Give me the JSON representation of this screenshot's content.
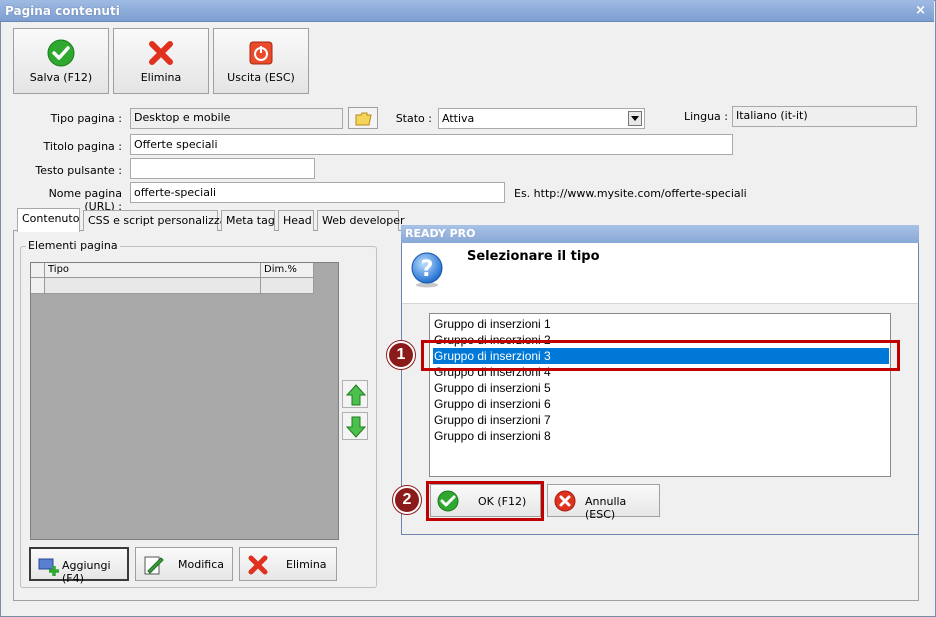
{
  "window": {
    "title": "Pagina contenuti",
    "close_glyph": "×"
  },
  "toolbar": [
    {
      "label": "Salva (F12)",
      "icon": "checkmark-icon"
    },
    {
      "label": "Elimina",
      "icon": "red-x-icon"
    },
    {
      "label": "Uscita (ESC)",
      "icon": "exit-icon"
    }
  ],
  "form": {
    "tipo_pagina_label": "Tipo pagina :",
    "tipo_pagina_value": "Desktop e mobile",
    "stato_label": "Stato :",
    "stato_value": "Attiva",
    "lingua_label": "Lingua :",
    "lingua_value": "Italiano (it-it)",
    "titolo_label": "Titolo pagina :",
    "titolo_value": "Offerte speciali",
    "testo_label": "Testo pulsante :",
    "testo_value": "",
    "nome_label": "Nome pagina (URL) :",
    "nome_value": "offerte-speciali",
    "url_example": "Es. http://www.mysite.com/offerte-speciali"
  },
  "tabs": [
    "Contenuto",
    "CSS e script personalizzati",
    "Meta tag",
    "Head",
    "Web developer"
  ],
  "elements": {
    "group_title": "Elementi pagina",
    "columns": [
      "Tipo",
      "Dim.%"
    ],
    "buttons": [
      "Aggiungi (F4)",
      "Modifica",
      "Elimina"
    ]
  },
  "dialog": {
    "title": "READY PRO",
    "heading": "Selezionare il tipo",
    "items": [
      "Gruppo di inserzioni 1",
      "Gruppo di inserzioni 2",
      "Gruppo di inserzioni 3",
      "Gruppo di inserzioni 4",
      "Gruppo di inserzioni 5",
      "Gruppo di inserzioni 6",
      "Gruppo di inserzioni 7",
      "Gruppo di inserzioni 8"
    ],
    "selected_index": 2,
    "ok_label": "OK (F12)",
    "cancel_label": "Annulla (ESC)"
  },
  "annotations": {
    "badge1": "1",
    "badge2": "2",
    "color": "#c00000"
  }
}
